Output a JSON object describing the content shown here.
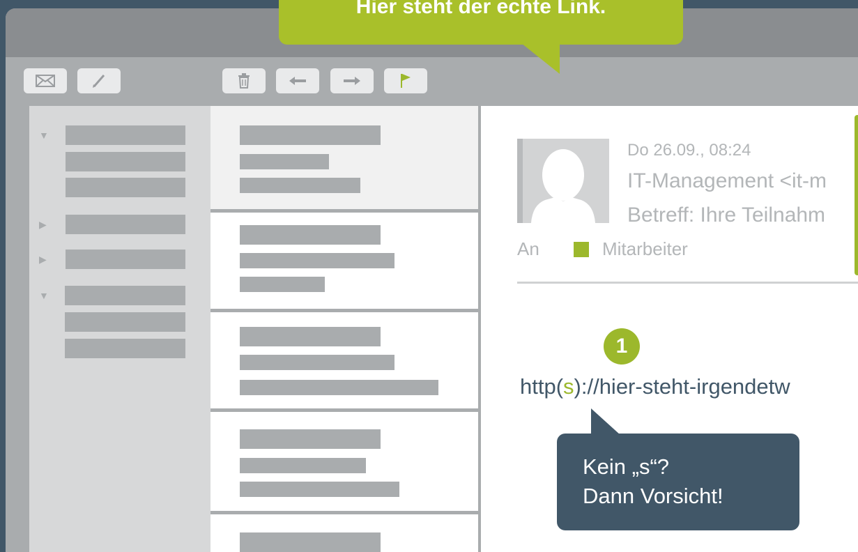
{
  "callout_top": {
    "text": "Hier steht der echte Link."
  },
  "toolbar": {
    "buttons": [
      {
        "icon": "mail-icon"
      },
      {
        "icon": "pencil-icon"
      },
      {
        "icon": "trash-icon"
      },
      {
        "icon": "arrow-left-icon"
      },
      {
        "icon": "arrow-right-icon"
      },
      {
        "icon": "flag-icon"
      }
    ]
  },
  "email": {
    "date": "Do 26.09., 08:24",
    "sender": "IT-Management <it-m",
    "subject": "Betreff: Ihre Teilnahm",
    "to_label": "An",
    "recipient": "Mitarbeiter",
    "step_number": "1",
    "url_prefix": "http(",
    "url_s": "s",
    "url_rest": ")://hier-steht-irgendetw"
  },
  "callout_bottom": {
    "line1": "Kein „s“?",
    "line2": "Dann Vorsicht!"
  },
  "colors": {
    "accent_green": "#9cb82c",
    "dark_slate": "#415768",
    "placeholder_gray": "#a9acae"
  }
}
